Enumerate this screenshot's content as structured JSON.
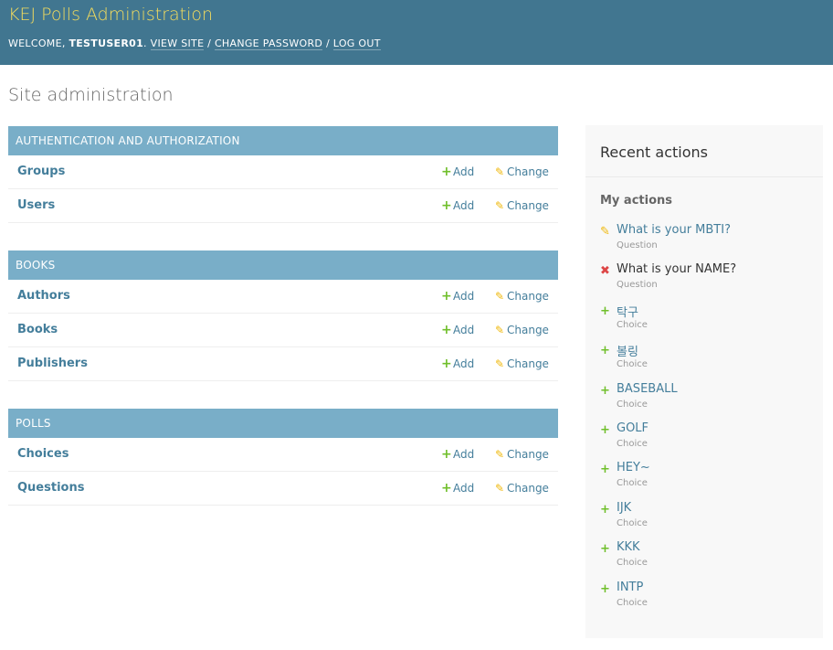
{
  "header": {
    "branding": "KEJ Polls Administration",
    "welcome": "WELCOME,",
    "username": "TESTUSER01",
    "view_site": "VIEW SITE",
    "change_password": "CHANGE PASSWORD",
    "log_out": "LOG OUT",
    "colors": {
      "bar": "#417690",
      "brand_text": "#f5dd5d"
    }
  },
  "page_title": "Site administration",
  "add_label": "Add",
  "change_label": "Change",
  "modules": [
    {
      "caption": "AUTHENTICATION AND AUTHORIZATION",
      "models": [
        "Groups",
        "Users"
      ]
    },
    {
      "caption": "BOOKS",
      "models": [
        "Authors",
        "Books",
        "Publishers"
      ]
    },
    {
      "caption": "POLLS",
      "models": [
        "Choices",
        "Questions"
      ]
    }
  ],
  "recent": {
    "title": "Recent actions",
    "subtitle": "My actions",
    "items": [
      {
        "icon": "pencil-icon",
        "name": "What is your MBTI?",
        "type": "Question"
      },
      {
        "icon": "delete-icon",
        "name": "What is your NAME?",
        "type": "Question"
      },
      {
        "icon": "plus-icon",
        "name": "탁구",
        "type": "Choice"
      },
      {
        "icon": "plus-icon",
        "name": "볼링",
        "type": "Choice"
      },
      {
        "icon": "plus-icon",
        "name": "BASEBALL",
        "type": "Choice"
      },
      {
        "icon": "plus-icon",
        "name": "GOLF",
        "type": "Choice"
      },
      {
        "icon": "plus-icon",
        "name": "HEY~",
        "type": "Choice"
      },
      {
        "icon": "plus-icon",
        "name": "IJK",
        "type": "Choice"
      },
      {
        "icon": "plus-icon",
        "name": "KKK",
        "type": "Choice"
      },
      {
        "icon": "plus-icon",
        "name": "INTP",
        "type": "Choice"
      }
    ]
  }
}
